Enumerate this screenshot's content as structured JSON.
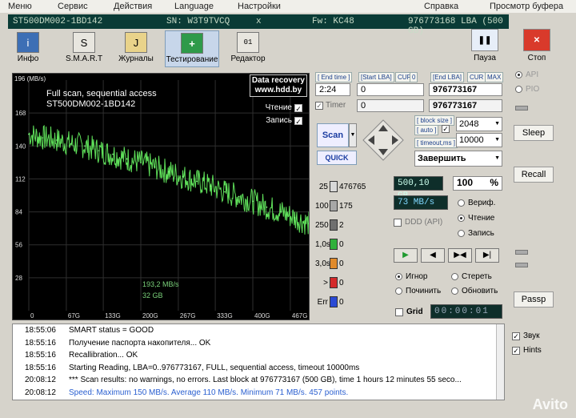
{
  "menu": [
    "Меню",
    "Сервис",
    "Действия",
    "Language",
    "Настройки",
    "Справка",
    "Просмотр буфера"
  ],
  "drive": {
    "model": "ST500DM002-1BD142",
    "sn": "SN: W3T9TVCQ",
    "x": "x",
    "fw": "Fw: KC48",
    "lba": "976773168 LBA (500 GB)"
  },
  "toolbar": [
    {
      "label": "Инфо",
      "icon": "i"
    },
    {
      "label": "S.M.A.R.T",
      "icon": "S"
    },
    {
      "label": "Журналы",
      "icon": "J"
    },
    {
      "label": "Тестирование",
      "icon": "+"
    },
    {
      "label": "Редактор",
      "icon": "01"
    }
  ],
  "pause_label": "Пауза",
  "stop_label": "Стоп",
  "graph": {
    "ymax_label": "196 (MB/s)",
    "title_line1": "Full scan, sequential access",
    "title_line2": "ST500DM002-1BD142",
    "ad_line1": "Data recovery",
    "ad_line2": "www.hdd.by",
    "legend_read": "Чтение",
    "legend_write": "Запись",
    "speed_now": "193,2 MB/s",
    "pos_now": "32 GB",
    "yticks": [
      "168",
      "140",
      "112",
      "84",
      "56",
      "28"
    ],
    "xticks": [
      "0",
      "67G",
      "133G",
      "200G",
      "267G",
      "333G",
      "400G",
      "467G"
    ]
  },
  "chart_data": {
    "type": "line",
    "x": [
      0,
      25,
      50,
      75,
      100,
      125,
      150,
      175,
      200,
      225,
      250,
      275,
      300,
      325,
      350,
      375,
      400,
      425,
      450,
      475,
      500
    ],
    "series": [
      {
        "values": [
          150,
          147,
          145,
          142,
          140,
          136,
          133,
          129,
          126,
          122,
          118,
          114,
          110,
          106,
          101,
          97,
          93,
          88,
          84,
          79,
          74
        ]
      }
    ],
    "xlim": [
      0,
      500
    ],
    "ylim": [
      0,
      196
    ],
    "grid": true,
    "xlabel": "",
    "ylabel": "MB/s"
  },
  "panel": {
    "end_time_lbl": "[ End time ]",
    "start_lba_lbl": "[Start LBA]",
    "cur1": "CUR",
    "zero": "0",
    "end_lba_lbl": "[End LBA]",
    "cur2": "CUR",
    "max": "MAX",
    "end_time": "2:24",
    "start_lba": "0",
    "end_lba": "976773167",
    "timer_lbl": "Timer",
    "timer_val": "0",
    "end_lba2": "976773167",
    "scan": "Scan",
    "quick": "QUICK",
    "block_size_lbl": "[ block size ]",
    "auto_lbl": "[ auto ]",
    "block_size": "2048",
    "timeout_lbl": "[ timeout,ms ]",
    "timeout": "10000",
    "action": "Завершить"
  },
  "hist": [
    {
      "n": "25",
      "v": "476765",
      "color": "#d8d8d8"
    },
    {
      "n": "100",
      "v": "175",
      "color": "#a7a7a7"
    },
    {
      "n": "250",
      "v": "2",
      "color": "#6f6f6f"
    },
    {
      "n": "1,0s",
      "v": "0",
      "color": "#2fb03a"
    },
    {
      "n": "3,0s",
      "v": "0",
      "color": "#e08a2a"
    },
    {
      "n": ">",
      "v": "0",
      "color": "#d42a2a"
    },
    {
      "n": "Err",
      "v": "0",
      "color": "#2a4ad4"
    }
  ],
  "status": {
    "size": "500,10 GB",
    "percent": "100",
    "pct_sign": "%",
    "speed": "73 MB/s",
    "ddd": "DDD (API)",
    "verify": "Вериф.",
    "read": "Чтение",
    "write": "Запись",
    "ignore": "Игнор",
    "erase": "Стереть",
    "repair": "Починить",
    "refresh": "Обновить",
    "grid": "Grid",
    "clock": "00:00:01"
  },
  "side": {
    "api": "API",
    "pio": "PIO",
    "sleep": "Sleep",
    "recall": "Recall",
    "passp": "Passp"
  },
  "log": [
    {
      "t": "18:55:06",
      "m": "SMART status = GOOD",
      "color": "#000"
    },
    {
      "t": "18:55:16",
      "m": "Получение паспорта накопителя... OK",
      "color": "#000"
    },
    {
      "t": "18:55:16",
      "m": "Recallibration... OK",
      "color": "#000"
    },
    {
      "t": "18:55:16",
      "m": "Starting Reading, LBA=0..976773167, FULL, sequential access, timeout 10000ms",
      "color": "#000"
    },
    {
      "t": "20:08:12",
      "m": "*** Scan results: no warnings, no errors. Last block at 976773167 (500 GB), time 1 hours 12 minutes 55 seco...",
      "color": "#000"
    },
    {
      "t": "20:08:12",
      "m": "Speed: Maximum 150 MB/s. Average 110 MB/s. Minimum 71 MB/s. 457 points.",
      "color": "#2a5fd0"
    }
  ],
  "options": {
    "sound": "Звук",
    "hints": "Hints"
  },
  "watermark": "Avito"
}
